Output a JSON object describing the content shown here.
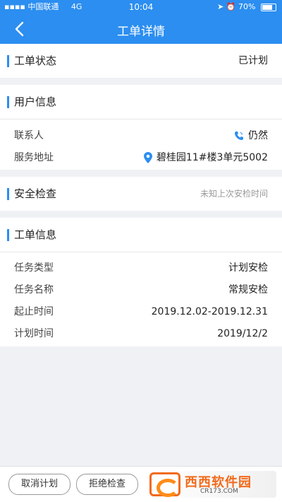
{
  "status_bar": {
    "carrier": "中国联通",
    "network": "4G",
    "time": "10:04",
    "battery": "70%"
  },
  "nav": {
    "title": "工单详情"
  },
  "order_status": {
    "label": "工单状态",
    "value": "已计划"
  },
  "user_info": {
    "title": "用户信息",
    "contact_label": "联系人",
    "contact_value": "仍然",
    "address_label": "服务地址",
    "address_value": "碧桂园11#楼3单元5002"
  },
  "safety_check": {
    "title": "安全检查",
    "hint": "未知上次安检时间"
  },
  "order_info": {
    "title": "工单信息",
    "rows": [
      {
        "label": "任务类型",
        "value": "计划安检"
      },
      {
        "label": "任务名称",
        "value": "常规安检"
      },
      {
        "label": "起止时间",
        "value": "2019.12.02-2019.12.31"
      },
      {
        "label": "计划时间",
        "value": "2019/12/2"
      }
    ]
  },
  "actions": {
    "cancel_plan": "取消计划",
    "reject_check": "拒绝检查"
  },
  "watermark": {
    "name": "西西软件园",
    "site": "CR173.COM"
  },
  "colors": {
    "accent": "#2b8ef0",
    "background": "#eff1f4"
  }
}
